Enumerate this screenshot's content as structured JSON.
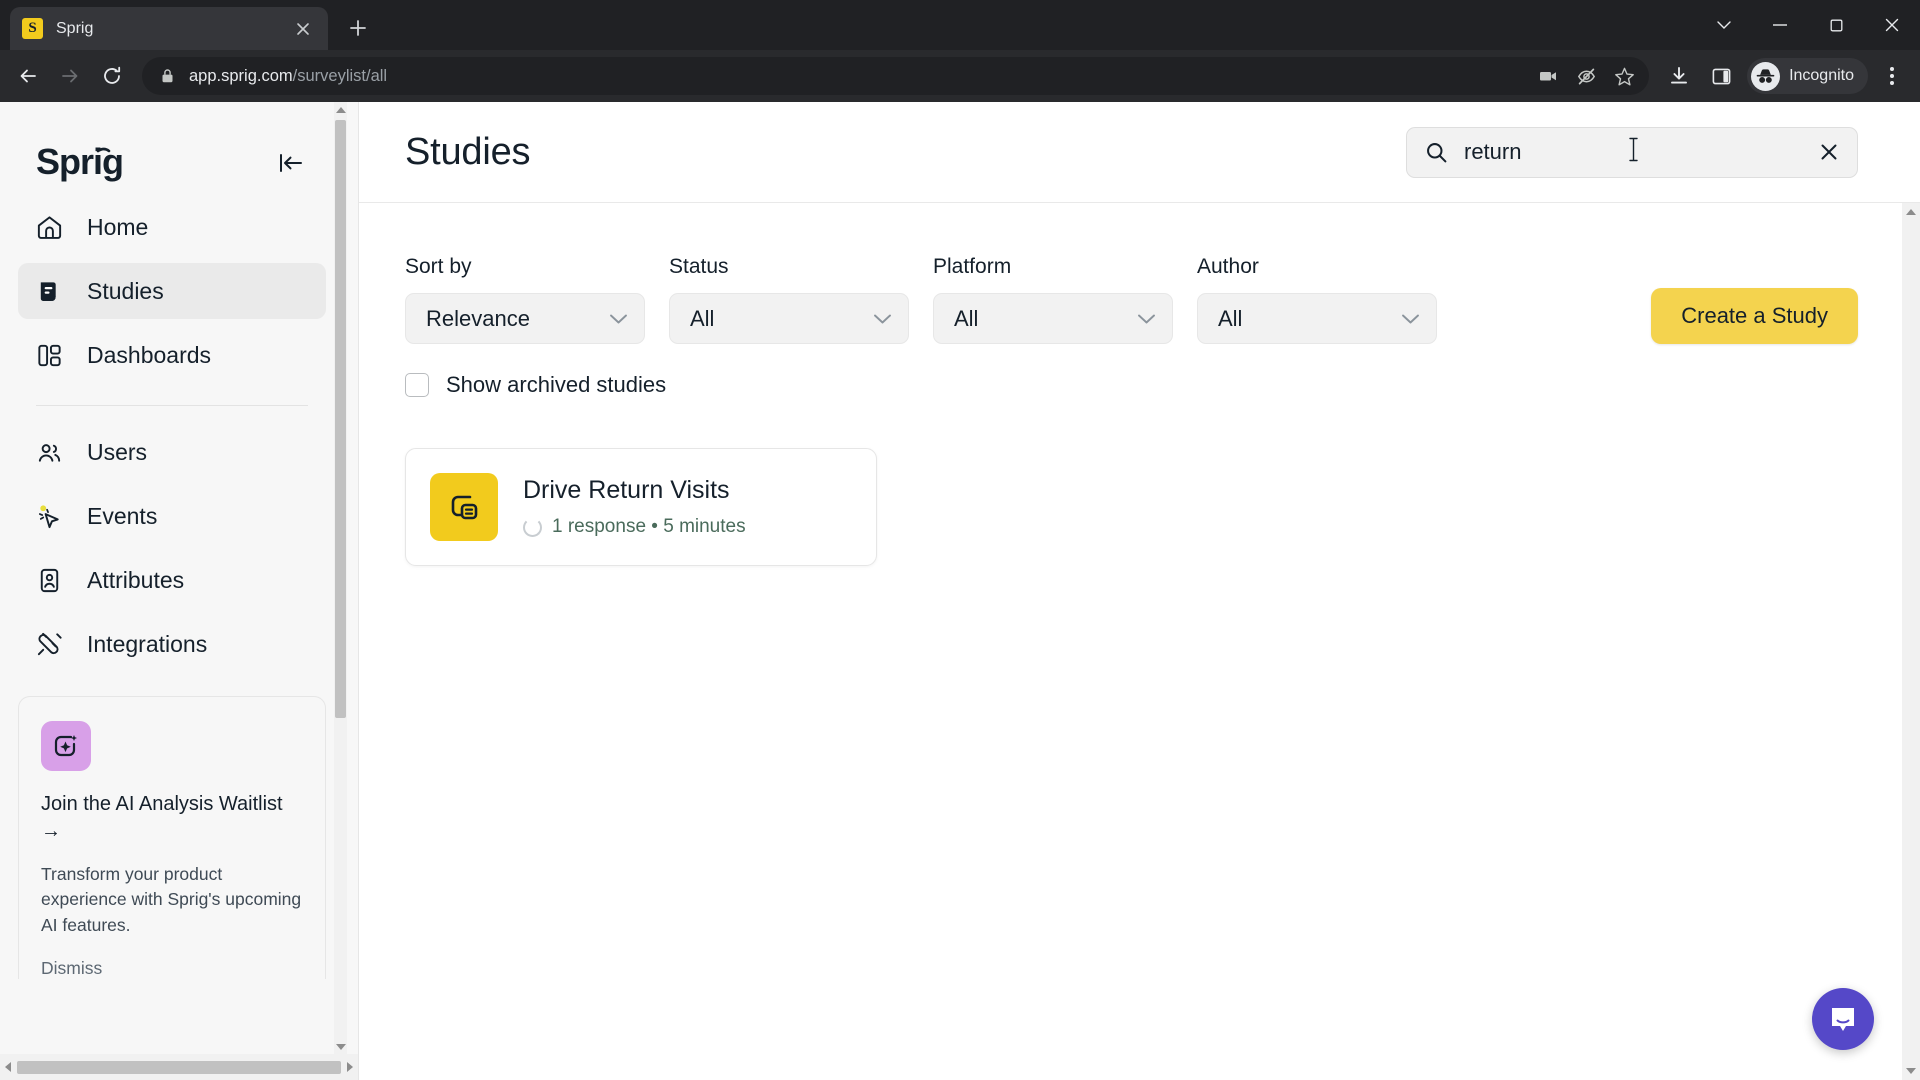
{
  "browser": {
    "tab": {
      "favicon_letter": "S",
      "title": "Sprig",
      "close_icon": "close-icon"
    },
    "new_tab_label": "+",
    "url": {
      "host": "app.sprig.com",
      "path": "/surveylist/all"
    },
    "profile_label": "Incognito",
    "window_controls": {
      "minimize": "–",
      "maximize": "□",
      "close": "✕",
      "search_tabs": "⌄"
    }
  },
  "sidebar": {
    "logo_text": "Sprig",
    "collapse_label": "collapse-sidebar",
    "items": [
      {
        "label": "Home",
        "icon": "home-icon",
        "active": false
      },
      {
        "label": "Studies",
        "icon": "studies-icon",
        "active": true
      },
      {
        "label": "Dashboards",
        "icon": "dashboards-icon",
        "active": false
      },
      {
        "label": "Users",
        "icon": "users-icon",
        "active": false
      },
      {
        "label": "Events",
        "icon": "events-cursor-icon",
        "active": false
      },
      {
        "label": "Attributes",
        "icon": "attributes-badge-icon",
        "active": false
      },
      {
        "label": "Integrations",
        "icon": "plug-icon",
        "active": false
      }
    ],
    "promo": {
      "icon": "ai-sparkle-icon",
      "title": "Join the AI Analysis Waitlist →",
      "body": "Transform your product experience with Sprig's upcoming AI features.",
      "dismiss_label": "Dismiss"
    }
  },
  "header": {
    "title": "Studies",
    "search": {
      "icon": "search-icon",
      "value": "return",
      "placeholder": "Search",
      "clear_icon": "close-icon"
    }
  },
  "filters": [
    {
      "label": "Sort by",
      "value": "Relevance",
      "name": "sort-by"
    },
    {
      "label": "Status",
      "value": "All",
      "name": "status"
    },
    {
      "label": "Platform",
      "value": "All",
      "name": "platform"
    },
    {
      "label": "Author",
      "value": "All",
      "name": "author"
    }
  ],
  "create_button_label": "Create a Study",
  "archived": {
    "label": "Show archived studies",
    "checked": false
  },
  "studies": [
    {
      "title": "Drive Return Visits",
      "responses": "1 response",
      "separator": "•",
      "duration": "5 minutes",
      "meta": "1 response • 5 minutes",
      "thumb_icon": "survey-card-icon"
    }
  ],
  "chat_widget": {
    "icon": "intercom-chat-icon"
  },
  "colors": {
    "brand_yellow": "#F2CB1D",
    "create_button": "#F4D34E",
    "ink": "#15202b",
    "promo_purple": "#D8A0E8",
    "chat_purple": "#5548C8",
    "meta_green": "#4A6B5B"
  }
}
